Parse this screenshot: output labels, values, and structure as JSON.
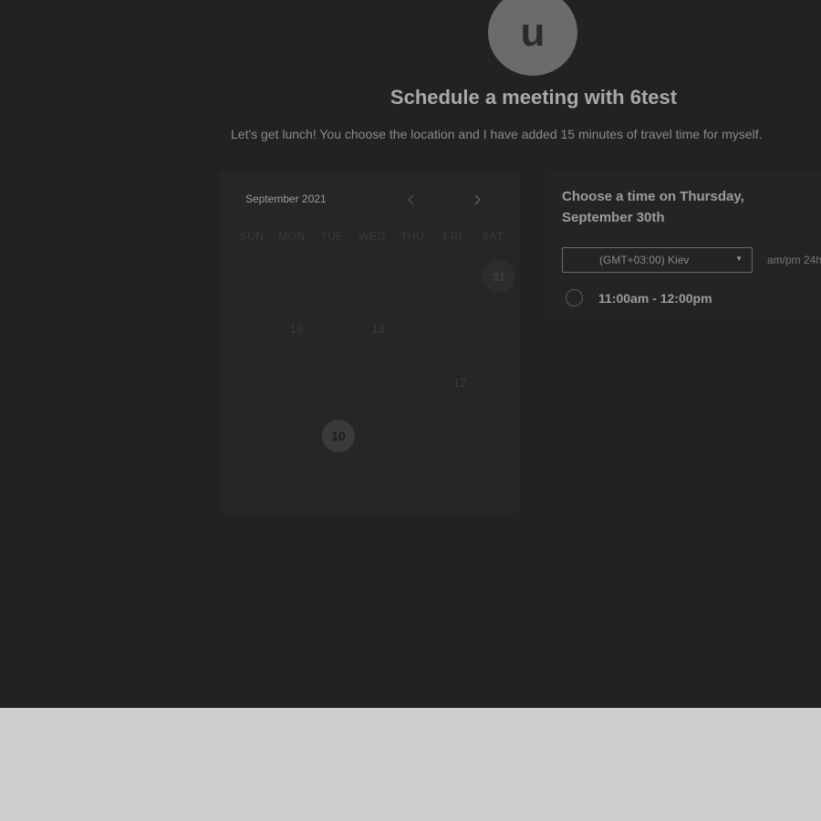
{
  "host": {
    "avatar_initial": "u",
    "title": "Schedule a meeting with 6test",
    "description": "Let's get lunch! You choose the location and I have added 15 minutes of travel time for myself."
  },
  "calendar": {
    "month_label": "September 2021",
    "prev_icon": "chevron-left-icon",
    "next_icon": "chevron-right-icon",
    "weekdays": [
      "SUN",
      "MON",
      "TUE",
      "WED",
      "THU",
      "FRI",
      "SAT"
    ],
    "days": {
      "d31": "31",
      "mon19": "19",
      "wed19": "19",
      "fri12": "12",
      "today": "10",
      "dot_a": "-",
      "dot_b": "-"
    }
  },
  "time_panel": {
    "heading": "Choose a time on Thursday, September 30th",
    "timezone": "(GMT+03:00) Kiev",
    "format_toggle": "am/pm  24h",
    "slots": [
      {
        "label": "11:00am - 12:00pm"
      }
    ]
  },
  "colors": {
    "overlay": "#222222",
    "footer": "#cfcfcf"
  }
}
